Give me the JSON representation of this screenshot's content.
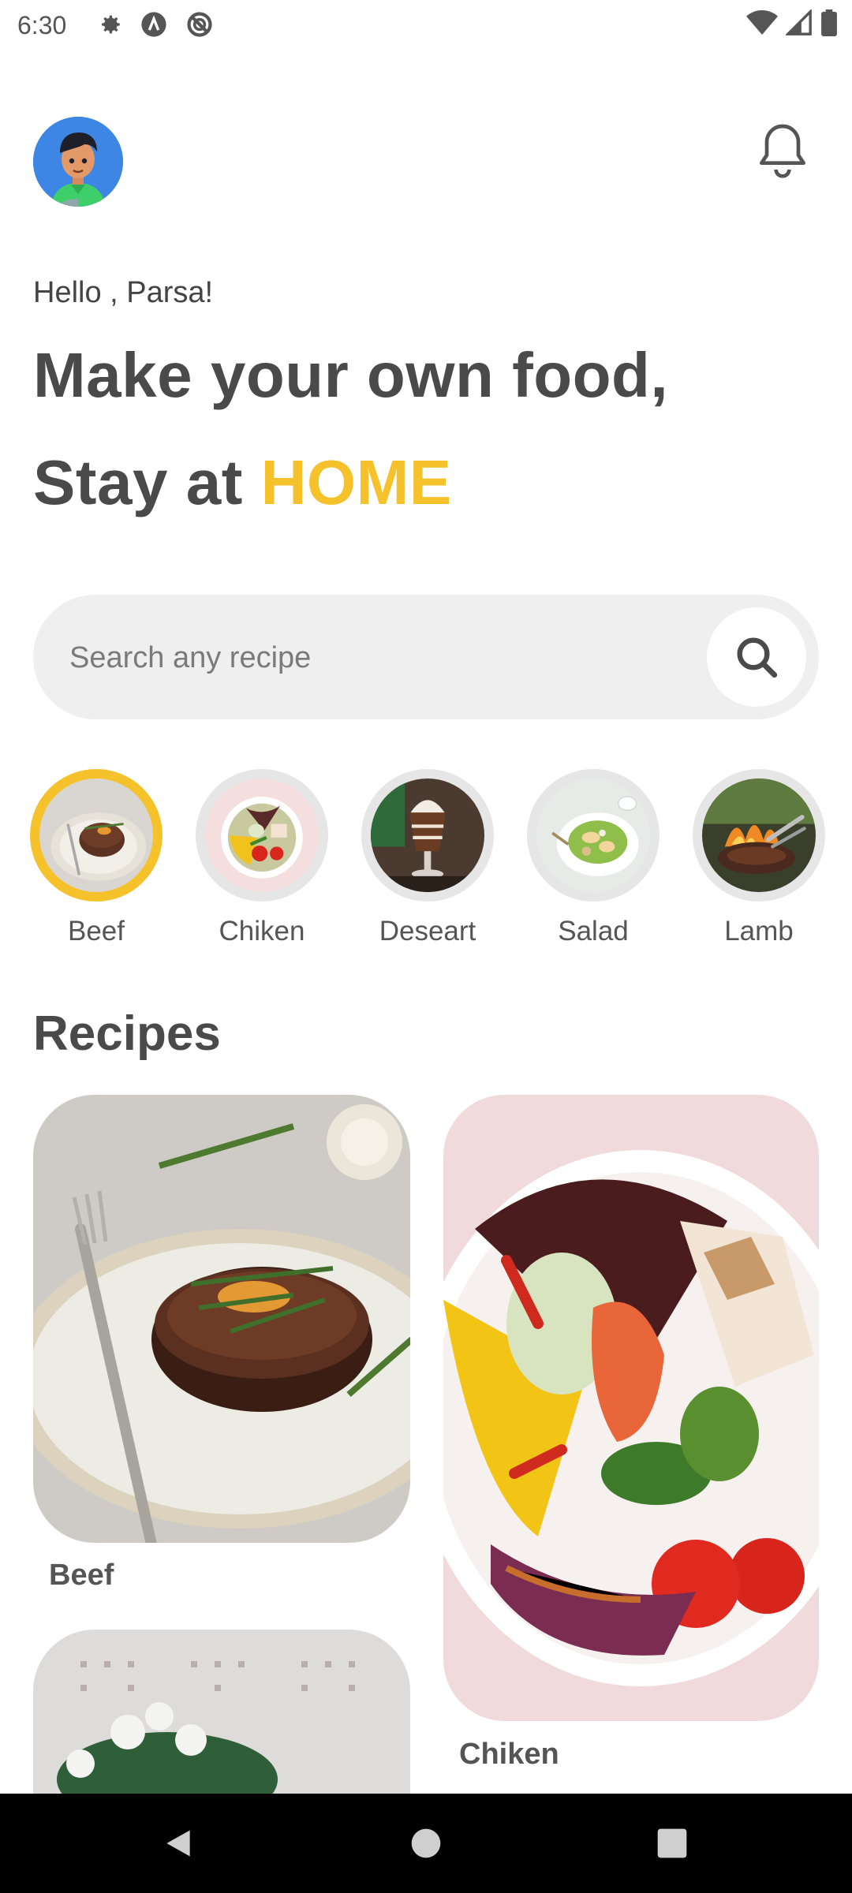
{
  "status": {
    "time": "6:30",
    "icons_left": [
      "gear-icon",
      "a-icon",
      "blocked-icon"
    ],
    "icons_right": [
      "wifi-icon",
      "signal-icon",
      "battery-icon"
    ]
  },
  "header": {
    "avatar": "avatar",
    "notification_icon": "bell-icon"
  },
  "greeting": "Hello , Parsa!",
  "headline": {
    "line1": "Make your own food,",
    "line2_prefix": "Stay at ",
    "line2_highlight": "HOME"
  },
  "search": {
    "placeholder": "Search any recipe",
    "button_icon": "search-icon"
  },
  "categories": [
    {
      "label": "Beef",
      "selected": true
    },
    {
      "label": "Chiken",
      "selected": false
    },
    {
      "label": "Deseart",
      "selected": false
    },
    {
      "label": "Salad",
      "selected": false
    },
    {
      "label": "Lamb",
      "selected": false
    }
  ],
  "recipes": {
    "title": "Recipes",
    "items": [
      {
        "label": "Beef"
      },
      {
        "label": "Chiken"
      },
      {
        "label": ""
      }
    ]
  },
  "colors": {
    "accent": "#f6c22c",
    "text": "#4a4a4a",
    "search_bg": "#efefef"
  },
  "nav": [
    "back-icon",
    "home-icon",
    "recents-icon"
  ]
}
